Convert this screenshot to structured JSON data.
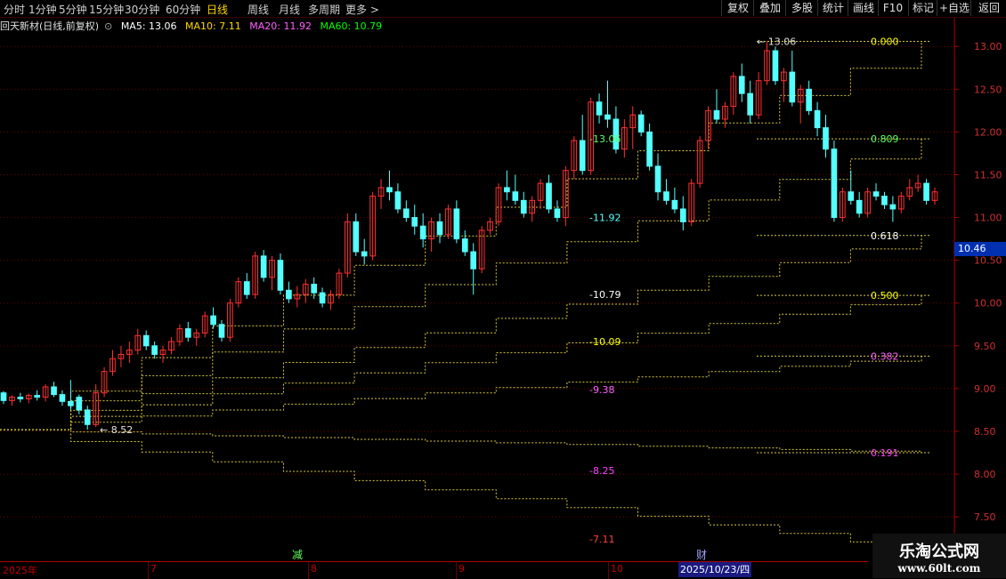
{
  "toolbar": {
    "periods": [
      "分时",
      "1分钟",
      "5分钟",
      "15分钟",
      "30分钟",
      "60分钟",
      "日线",
      "周线",
      "月线",
      "多周期",
      "更多 >"
    ],
    "active_period": "日线",
    "right_buttons": [
      "复权",
      "叠加",
      "多股",
      "统计",
      "画线",
      "F10",
      "+自选",
      "返回"
    ],
    "mark_label": "标记"
  },
  "infobar": {
    "title": "回天新材(日线,前复权)",
    "ma5": "MA5: 13.06",
    "ma10": "MA10: 7.11",
    "ma20": "MA20: 11.92",
    "ma60": "MA60: 10.79",
    "colors": {
      "title": "#e0e0e0",
      "ma5": "#ffffff",
      "ma10": "#ffd700",
      "ma20": "#ff60ff",
      "ma60": "#00ff00"
    }
  },
  "current_price": "10.46",
  "date_axis": {
    "labels": [
      "2025年",
      "7",
      "8",
      "9",
      "10"
    ],
    "cursor_date": "2025/10/23/四",
    "markers": [
      "减",
      "财"
    ]
  },
  "watermark": {
    "title": "乐淘公式网",
    "url": "www.60lt.com"
  },
  "chart_data": {
    "type": "candlestick",
    "y_ticks": [
      13.0,
      12.5,
      12.0,
      11.5,
      11.0,
      10.5,
      10.0,
      9.5,
      9.0,
      8.5,
      8.0,
      7.5
    ],
    "ylim": [
      7.2,
      13.2
    ],
    "grid": true,
    "up_color": "#ff3030",
    "down_color": "#54ffff",
    "candles": [
      [
        8.95,
        8.97,
        8.82,
        8.86
      ],
      [
        8.86,
        8.92,
        8.8,
        8.9
      ],
      [
        8.9,
        8.95,
        8.84,
        8.88
      ],
      [
        8.88,
        8.94,
        8.83,
        8.92
      ],
      [
        8.92,
        8.98,
        8.86,
        8.9
      ],
      [
        8.9,
        9.05,
        8.85,
        9.02
      ],
      [
        9.02,
        9.08,
        8.9,
        8.93
      ],
      [
        8.93,
        8.98,
        8.8,
        8.85
      ],
      [
        8.85,
        9.1,
        8.75,
        8.8
      ],
      [
        8.9,
        8.93,
        8.7,
        8.75
      ],
      [
        8.75,
        8.8,
        8.52,
        8.58
      ],
      [
        8.58,
        9.05,
        8.55,
        8.95
      ],
      [
        8.95,
        9.25,
        8.9,
        9.2
      ],
      [
        9.2,
        9.45,
        9.15,
        9.35
      ],
      [
        9.35,
        9.5,
        9.25,
        9.4
      ],
      [
        9.4,
        9.55,
        9.3,
        9.45
      ],
      [
        9.45,
        9.7,
        9.4,
        9.62
      ],
      [
        9.62,
        9.68,
        9.45,
        9.5
      ],
      [
        9.5,
        9.55,
        9.35,
        9.4
      ],
      [
        9.4,
        9.5,
        9.3,
        9.45
      ],
      [
        9.45,
        9.6,
        9.4,
        9.55
      ],
      [
        9.55,
        9.75,
        9.5,
        9.7
      ],
      [
        9.7,
        9.78,
        9.55,
        9.6
      ],
      [
        9.6,
        9.7,
        9.5,
        9.65
      ],
      [
        9.65,
        9.9,
        9.6,
        9.85
      ],
      [
        9.85,
        9.95,
        9.7,
        9.75
      ],
      [
        9.75,
        9.8,
        9.55,
        9.6
      ],
      [
        9.6,
        10.05,
        9.55,
        10.0
      ],
      [
        10.0,
        10.3,
        9.95,
        10.25
      ],
      [
        10.25,
        10.35,
        10.05,
        10.1
      ],
      [
        10.1,
        10.6,
        10.05,
        10.55
      ],
      [
        10.55,
        10.62,
        10.25,
        10.3
      ],
      [
        10.3,
        10.55,
        10.15,
        10.5
      ],
      [
        10.5,
        10.58,
        10.1,
        10.15
      ],
      [
        10.15,
        10.25,
        10.0,
        10.05
      ],
      [
        10.05,
        10.2,
        9.95,
        10.1
      ],
      [
        10.1,
        10.28,
        10.0,
        10.22
      ],
      [
        10.22,
        10.3,
        10.05,
        10.12
      ],
      [
        10.12,
        10.18,
        9.95,
        10.0
      ],
      [
        10.0,
        10.15,
        9.92,
        10.1
      ],
      [
        10.1,
        10.4,
        10.05,
        10.35
      ],
      [
        10.35,
        11.05,
        10.3,
        10.95
      ],
      [
        10.95,
        11.05,
        10.55,
        10.6
      ],
      [
        10.6,
        10.75,
        10.45,
        10.55
      ],
      [
        10.55,
        11.3,
        10.5,
        11.25
      ],
      [
        11.25,
        11.45,
        11.1,
        11.35
      ],
      [
        11.35,
        11.55,
        11.2,
        11.3
      ],
      [
        11.3,
        11.4,
        11.05,
        11.1
      ],
      [
        11.1,
        11.2,
        10.95,
        11.0
      ],
      [
        11.0,
        11.15,
        10.8,
        10.9
      ],
      [
        10.9,
        11.05,
        10.65,
        10.75
      ],
      [
        10.75,
        11.0,
        10.6,
        10.95
      ],
      [
        10.95,
        11.05,
        10.7,
        10.8
      ],
      [
        10.8,
        11.15,
        10.75,
        11.1
      ],
      [
        11.1,
        11.2,
        10.7,
        10.75
      ],
      [
        10.75,
        10.85,
        10.55,
        10.6
      ],
      [
        10.6,
        10.7,
        10.1,
        10.4
      ],
      [
        10.4,
        10.9,
        10.35,
        10.85
      ],
      [
        10.85,
        11.0,
        10.8,
        10.95
      ],
      [
        10.95,
        11.4,
        10.9,
        11.35
      ],
      [
        11.35,
        11.55,
        11.2,
        11.3
      ],
      [
        11.3,
        11.5,
        11.15,
        11.2
      ],
      [
        11.2,
        11.3,
        11.0,
        11.05
      ],
      [
        11.05,
        11.25,
        10.95,
        11.2
      ],
      [
        11.2,
        11.45,
        11.1,
        11.4
      ],
      [
        11.4,
        11.5,
        11.05,
        11.1
      ],
      [
        11.1,
        11.2,
        10.95,
        11.0
      ],
      [
        11.0,
        11.6,
        10.9,
        11.55
      ],
      [
        11.55,
        11.95,
        11.45,
        11.9
      ],
      [
        11.9,
        12.2,
        11.5,
        11.55
      ],
      [
        11.55,
        12.4,
        11.5,
        12.35
      ],
      [
        12.35,
        12.45,
        12.1,
        12.2
      ],
      [
        12.2,
        12.6,
        12.05,
        12.15
      ],
      [
        12.15,
        12.3,
        11.75,
        11.8
      ],
      [
        11.8,
        12.15,
        11.7,
        12.05
      ],
      [
        12.05,
        12.3,
        11.8,
        12.2
      ],
      [
        12.2,
        12.25,
        11.95,
        12.0
      ],
      [
        12.0,
        12.1,
        11.55,
        11.6
      ],
      [
        11.6,
        11.75,
        11.2,
        11.3
      ],
      [
        11.3,
        11.45,
        11.15,
        11.2
      ],
      [
        11.2,
        11.35,
        11.05,
        11.1
      ],
      [
        11.1,
        11.25,
        10.85,
        10.95
      ],
      [
        10.95,
        11.45,
        10.9,
        11.4
      ],
      [
        11.4,
        11.95,
        11.35,
        11.9
      ],
      [
        11.9,
        12.3,
        11.8,
        12.25
      ],
      [
        12.25,
        12.5,
        12.1,
        12.15
      ],
      [
        12.15,
        12.35,
        12.05,
        12.3
      ],
      [
        12.3,
        12.7,
        12.2,
        12.65
      ],
      [
        12.65,
        12.8,
        12.35,
        12.45
      ],
      [
        12.45,
        12.6,
        12.1,
        12.2
      ],
      [
        12.2,
        12.7,
        12.15,
        12.6
      ],
      [
        12.6,
        13.06,
        12.55,
        12.95
      ],
      [
        12.95,
        13.0,
        12.55,
        12.6
      ],
      [
        12.6,
        12.75,
        12.35,
        12.7
      ],
      [
        12.7,
        12.95,
        12.3,
        12.35
      ],
      [
        12.35,
        12.55,
        12.1,
        12.5
      ],
      [
        12.5,
        12.6,
        12.2,
        12.25
      ],
      [
        12.25,
        12.35,
        11.95,
        12.05
      ],
      [
        12.05,
        12.2,
        11.7,
        11.8
      ],
      [
        11.8,
        11.9,
        10.95,
        11.0
      ],
      [
        11.0,
        11.35,
        10.95,
        11.3
      ],
      [
        11.3,
        11.55,
        11.15,
        11.2
      ],
      [
        11.2,
        11.3,
        11.0,
        11.05
      ],
      [
        11.05,
        11.35,
        11.0,
        11.3
      ],
      [
        11.3,
        11.4,
        11.2,
        11.25
      ],
      [
        11.25,
        11.3,
        11.1,
        11.15
      ],
      [
        11.15,
        11.25,
        10.95,
        11.1
      ],
      [
        11.1,
        11.3,
        11.05,
        11.25
      ],
      [
        11.25,
        11.45,
        11.2,
        11.35
      ],
      [
        11.35,
        11.5,
        11.3,
        11.4
      ],
      [
        11.4,
        11.45,
        11.15,
        11.2
      ],
      [
        11.2,
        11.35,
        11.15,
        11.3
      ]
    ],
    "step_lines": [
      {
        "name": "13.06",
        "color": "#d7c83a",
        "values": [
          8.52,
          13.06
        ]
      },
      {
        "name": "11.92",
        "color": "#d7c83a",
        "values": [
          8.52,
          11.92
        ]
      },
      {
        "name": "10.79",
        "color": "#d7c83a",
        "values": [
          8.52,
          10.79
        ]
      },
      {
        "name": "10.09",
        "color": "#d7c83a",
        "values": [
          8.52,
          10.09
        ]
      },
      {
        "name": "9.38",
        "color": "#d7c83a",
        "values": [
          8.52,
          9.38
        ]
      },
      {
        "name": "8.25",
        "color": "#d7c83a",
        "values": [
          8.52,
          8.25
        ]
      },
      {
        "name": "7.11",
        "color": "#d7c83a",
        "values": [
          8.52,
          7.11
        ]
      }
    ],
    "fib_levels": [
      {
        "label": "0.809",
        "value": 11.92,
        "color": "#60ff60"
      },
      {
        "label": "0.618",
        "value": 10.79,
        "color": "#ffffff"
      },
      {
        "label": "0.500",
        "value": 10.09,
        "color": "#ffff00"
      },
      {
        "label": "0.382",
        "value": 9.38,
        "color": "#ff60ff"
      },
      {
        "label": "0.191",
        "value": 8.25,
        "color": "#ff40ff"
      },
      {
        "label": "0.000",
        "value": 13.06,
        "color": "#ffff00"
      }
    ],
    "annotations": [
      {
        "text": "13.06",
        "value": 13.06
      },
      {
        "text": "8.52",
        "value": 8.52
      },
      {
        "text": "13.06",
        "value": 11.92,
        "color": "#60ff60"
      },
      {
        "text": "11.92",
        "value": 11.0,
        "color": "#54ffff"
      },
      {
        "text": "10.79",
        "value": 10.1,
        "color": "#ffffff"
      },
      {
        "text": "10.09",
        "value": 9.55,
        "color": "#ffff00"
      },
      {
        "text": "9.38",
        "value": 8.99,
        "color": "#ff60ff"
      },
      {
        "text": "8.25",
        "value": 8.04,
        "color": "#ff40ff"
      },
      {
        "text": "7.11",
        "value": 7.24,
        "color": "#ff4040"
      }
    ]
  }
}
